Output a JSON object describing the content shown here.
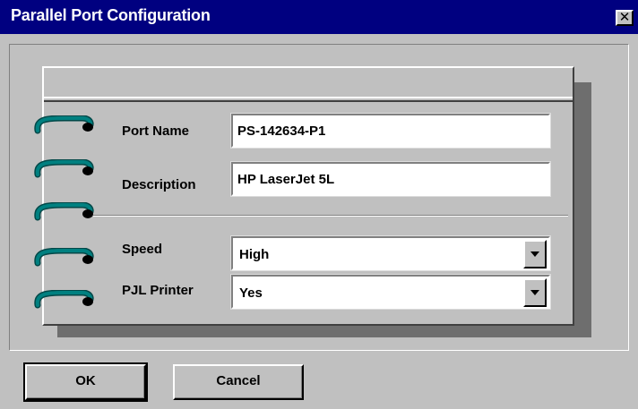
{
  "window": {
    "title": "Parallel Port Configuration",
    "close_glyph": "✕"
  },
  "form": {
    "port_name": {
      "label": "Port Name",
      "value": "PS-142634-P1"
    },
    "description": {
      "label": "Description",
      "value": "HP LaserJet 5L"
    },
    "speed": {
      "label": "Speed",
      "value": "High"
    },
    "pjl_printer": {
      "label": "PJL Printer",
      "value": "Yes"
    }
  },
  "buttons": {
    "ok": "OK",
    "cancel": "Cancel"
  },
  "colors": {
    "titlebar": "#000080",
    "face": "#c0c0c0",
    "ring": "#008080"
  },
  "icons": [
    "close-icon",
    "notebook-ring-icon",
    "dropdown-arrow-icon"
  ]
}
